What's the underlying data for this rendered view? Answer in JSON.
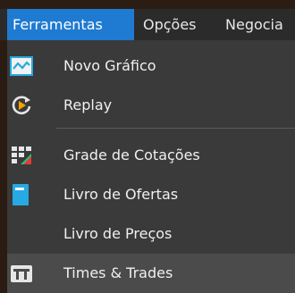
{
  "menubar": {
    "tabs": [
      {
        "label": "Ferramentas"
      },
      {
        "label": "Opções"
      },
      {
        "label": "Negocia"
      }
    ]
  },
  "menu": {
    "items": [
      {
        "label": "Novo Gráfico",
        "icon": "chart-line-icon"
      },
      {
        "label": "Replay",
        "icon": "replay-icon"
      },
      {
        "label": "Grade de Cotações",
        "icon": "quote-grid-icon"
      },
      {
        "label": "Livro de Ofertas",
        "icon": "order-book-icon"
      },
      {
        "label": "Livro de Preços",
        "icon": ""
      },
      {
        "label": "Times & Trades",
        "icon": "times-trades-icon"
      }
    ]
  },
  "colors": {
    "menubar_bg": "#2b2b2b",
    "active_tab": "#1f7ad1",
    "dropdown_bg": "#3a3a3a",
    "hover_row": "#4b4b4b",
    "accent_blue": "#27a9e1",
    "accent_orange": "#f4a400",
    "accent_red": "#e83a3a",
    "accent_green": "#29c17a"
  }
}
